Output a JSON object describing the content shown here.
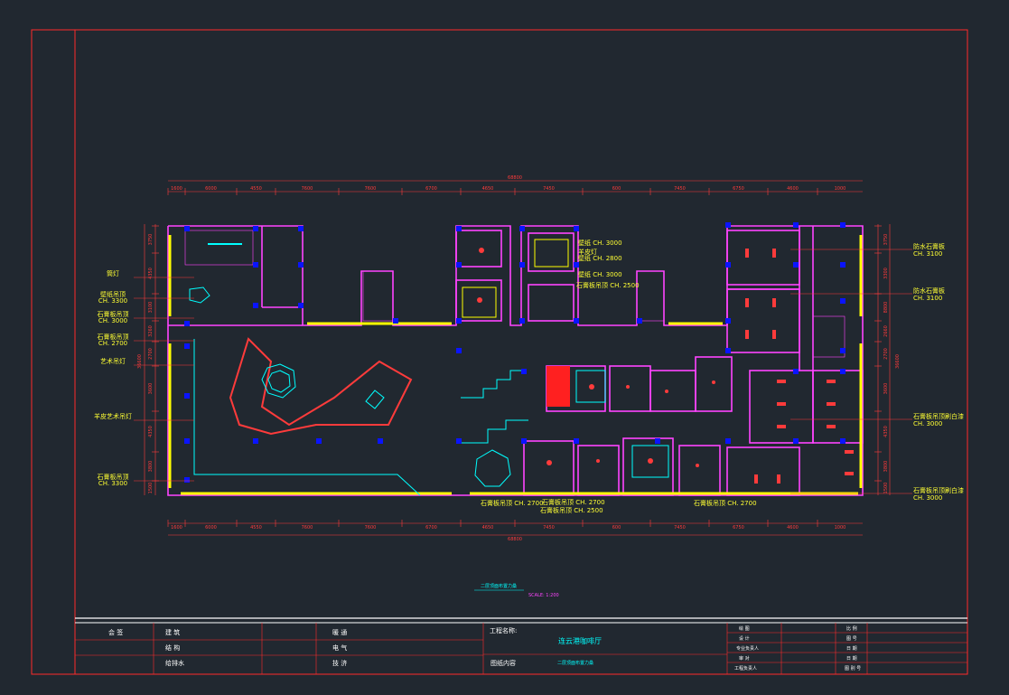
{
  "colors": {
    "background": "#212830",
    "frame": "#ff2a2a",
    "wall": "#ff44ff",
    "column": "#0a14ff",
    "window": "#ffff00",
    "accent": "#00ffff",
    "dimension": "#ff3b3b",
    "label": "#ffff33",
    "titleblock_text": "#ffffff"
  },
  "drawing": {
    "scale_title": "二层顶面布置力桑",
    "scale_text": "SCALE:  1:200",
    "dims_top": [
      "1600",
      "6000",
      "4550",
      "7600",
      "7600",
      "6700",
      "4650",
      "7450",
      "600",
      "7450",
      "6750",
      "4600",
      "1000"
    ],
    "dims_total_top": "68800",
    "dims_bottom": [
      "1600",
      "6000",
      "4550",
      "7600",
      "7600",
      "6700",
      "4650",
      "7450",
      "600",
      "7450",
      "6750",
      "4600",
      "1000"
    ],
    "dims_total_bottom": "68800",
    "dims_left": [
      "3750",
      "4350",
      "3100",
      "3260",
      "2700",
      "3600",
      "4350",
      "3800",
      "1500"
    ],
    "dims_left_total": "36600",
    "dims_right": [
      "3750",
      "3300",
      "8800",
      "2660",
      "2700",
      "3600",
      "4350",
      "3800",
      "1500"
    ],
    "dims_right_total": "36600",
    "left_labels": [
      {
        "line1": "筒灯",
        "line2": ""
      },
      {
        "line1": "壁纸吊顶",
        "line2": "CH. 3300"
      },
      {
        "line1": "石膏板吊顶",
        "line2": "CH. 3000"
      },
      {
        "line1": "石膏板吊顶",
        "line2": "CH. 2700"
      },
      {
        "line1": "艺术吊灯",
        "line2": ""
      },
      {
        "line1": "羊皮艺术吊灯",
        "line2": ""
      },
      {
        "line1": "石膏板吊顶",
        "line2": "CH. 3300"
      }
    ],
    "center_labels": [
      {
        "line1": "壁纸",
        "line2": "CH. 3000"
      },
      {
        "line1": "羊皮灯",
        "line2": ""
      },
      {
        "line1": "壁纸",
        "line2": "CH. 2800"
      },
      {
        "line1": "壁纸",
        "line2": "CH. 3000"
      },
      {
        "line1": "石膏板吊顶",
        "line2": "CH. 2500"
      }
    ],
    "right_labels": [
      {
        "line1": "防水石膏板",
        "line2": "CH. 3100"
      },
      {
        "line1": "防水石膏板",
        "line2": "CH. 3100"
      },
      {
        "line1": "石膏板吊顶刷白漆",
        "line2": "CH. 3000"
      },
      {
        "line1": "石膏板吊顶刷白漆",
        "line2": "CH. 3000"
      }
    ],
    "bottom_labels": [
      {
        "text": "石膏板吊顶  CH. 2700"
      },
      {
        "text": "石膏板吊顶  CH. 2700"
      },
      {
        "text": "石膏板吊顶  CH. 2500"
      },
      {
        "text": "石膏板吊顶  CH. 2700"
      }
    ]
  },
  "titleblock": {
    "sign_label": "会 签",
    "disciplines_left": [
      "建 筑",
      "结 构",
      "给排水"
    ],
    "disciplines_mid": [
      "暖 通",
      "电 气",
      "技 济"
    ],
    "project_label": "工程名称:",
    "project_name": "连云港咖啡厅",
    "content_label": "图纸内容",
    "content_value": "二层顶面布置力桑",
    "roles": [
      "绘 图",
      "设 计",
      "专业负责人",
      "审 对",
      "工程负责人"
    ],
    "meta_labels": [
      "比 例",
      "图 号",
      "日 期",
      "日 期",
      "图 别 号"
    ]
  }
}
